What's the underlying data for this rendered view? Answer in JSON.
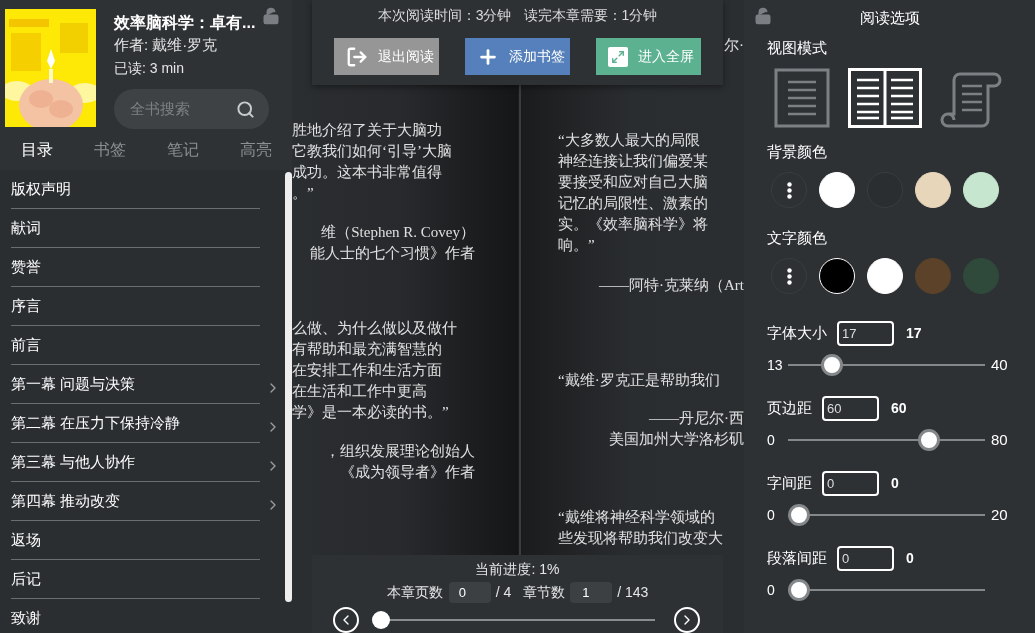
{
  "sidebar": {
    "book": {
      "title": "效率脑科学：卓有...",
      "author": "作者: 戴维·罗克",
      "read_time": "已读: 3 min"
    },
    "search": {
      "placeholder": "全书搜索"
    },
    "tabs": [
      {
        "label": "目录",
        "selected": true
      },
      {
        "label": "书签",
        "selected": false
      },
      {
        "label": "笔记",
        "selected": false
      },
      {
        "label": "高亮",
        "selected": false
      }
    ],
    "toc": [
      {
        "label": "版权声明",
        "expandable": false
      },
      {
        "label": "献词",
        "expandable": false
      },
      {
        "label": "赞誉",
        "expandable": false
      },
      {
        "label": "序言",
        "expandable": false
      },
      {
        "label": "前言",
        "expandable": false
      },
      {
        "label": "第一幕 问题与决策",
        "expandable": true
      },
      {
        "label": "第二幕 在压力下保持冷静",
        "expandable": true
      },
      {
        "label": "第三幕 与他人协作",
        "expandable": true
      },
      {
        "label": "第四幕 推动改变",
        "expandable": true
      },
      {
        "label": "返场",
        "expandable": false
      },
      {
        "label": "后记",
        "expandable": false
      },
      {
        "label": "致谢",
        "expandable": false
      }
    ]
  },
  "pages": [
    {
      "blocks": [
        {
          "kind": "quote",
          "lines": [
            "胜地介绍了关于大脑功",
            "它教我们如何‘引导’大脑",
            "成功。这本书非常值得",
            "。”"
          ]
        },
        {
          "kind": "attribution",
          "lines": [
            "维（Stephen R. Covey）",
            "能人士的七个习惯》作者"
          ]
        },
        {
          "kind": "quote",
          "lines": [
            "么做、为什么做以及做什",
            "有帮助和最充满智慧的",
            "在安排工作和生活方面",
            "在生活和工作中更高",
            "学》是一本必读的书。”"
          ]
        },
        {
          "kind": "attribution",
          "lines": [
            "，组织发展理论创始人",
            "《成为领导者》作者"
          ]
        }
      ]
    },
    {
      "blocks": [
        {
          "kind": "attribution",
          "lines": [
            "尔·"
          ]
        },
        {
          "kind": "quote",
          "lines": [
            "“大多数人最大的局限",
            "神经连接让我们偏爱某",
            "要接受和应对自己大脑",
            "记忆的局限性、激素的",
            "实。《效率脑科学》将",
            "响。”"
          ]
        },
        {
          "kind": "attribution",
          "lines": [
            "——阿特·克莱纳（Art"
          ]
        },
        {
          "kind": "quote",
          "lines": [
            "“戴维·罗克正是帮助我们"
          ]
        },
        {
          "kind": "attribution",
          "lines": [
            "——丹尼尔·西",
            "美国加州大学洛杉矶"
          ]
        },
        {
          "kind": "quote",
          "lines": [
            "“戴维将神经科学领域的",
            "些发现将帮助我们改变大"
          ]
        }
      ]
    }
  ],
  "top_bar": {
    "stats": [
      "本次阅读时间：3分钟",
      "读完本章需要：1分钟"
    ],
    "buttons": [
      {
        "kind": "exit",
        "label": "退出阅读"
      },
      {
        "kind": "bookmark",
        "label": "添加书签"
      },
      {
        "kind": "fullscreen",
        "label": "进入全屏"
      }
    ]
  },
  "bottom_bar": {
    "progress": "当前进度: 1%",
    "page_label": "本章页数",
    "page_value": "0",
    "page_total": "/ 4",
    "chapter_label": "章节数",
    "chapter_value": "1",
    "chapter_total": "/ 143",
    "slider": {
      "level": 0.01
    }
  },
  "options": {
    "title": "阅读选项",
    "view_mode": {
      "label": "视图模式",
      "modes": [
        {
          "kind": "single",
          "selected": false
        },
        {
          "kind": "double",
          "selected": true
        },
        {
          "kind": "scroll",
          "selected": false
        }
      ]
    },
    "background": {
      "label": "背景颜色",
      "swatches": [
        {
          "kind": "more"
        },
        {
          "kind": "color",
          "color": "#ffffff"
        },
        {
          "kind": "color",
          "color": "#2b2e31"
        },
        {
          "kind": "color",
          "color": "#e8d6bb"
        },
        {
          "kind": "color",
          "color": "#c6e6cf"
        }
      ]
    },
    "text_color": {
      "label": "文字颜色",
      "swatches": [
        {
          "kind": "more"
        },
        {
          "kind": "color",
          "color": "#000000"
        },
        {
          "kind": "color",
          "color": "#ffffff"
        },
        {
          "kind": "color",
          "color": "#5b4229"
        },
        {
          "kind": "color",
          "color": "#2f4a3a"
        }
      ]
    },
    "settings": [
      {
        "label": "字体大小",
        "input": "17",
        "value": "17",
        "min": "13",
        "max": "40",
        "level": 0.19
      },
      {
        "label": "页边距",
        "input": "60",
        "value": "60",
        "min": "0",
        "max": "80",
        "level": 0.74
      },
      {
        "label": "字间距",
        "input": "0",
        "value": "0",
        "min": "0",
        "max": "20",
        "level": 0
      },
      {
        "label": "段落间距",
        "input": "0",
        "value": "0",
        "min": "0",
        "level": 0
      }
    ]
  }
}
